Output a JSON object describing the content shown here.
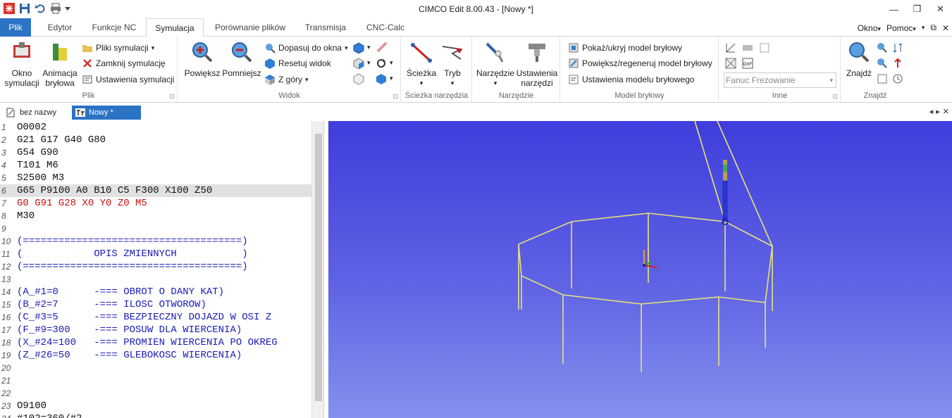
{
  "window": {
    "title": "CIMCO Edit 8.00.43 - [Nowy *]",
    "min": "—",
    "restore": "❐",
    "close": "✕"
  },
  "qat": {
    "icons": [
      "app-icon",
      "save-icon",
      "undo-icon",
      "print-icon",
      "dropdown-icon"
    ]
  },
  "tabs": [
    {
      "label": "Plik"
    },
    {
      "label": "Edytor"
    },
    {
      "label": "Funkcje NC"
    },
    {
      "label": "Symulacja"
    },
    {
      "label": "Porównanie plików"
    },
    {
      "label": "Transmisja"
    },
    {
      "label": "CNC-Calc"
    }
  ],
  "menus": {
    "okno": "Okno",
    "pomoc": "Pomoc",
    "arrow": "▾",
    "up": "▾",
    "pin": "⧉",
    "x": "✕"
  },
  "ribbon": {
    "plik": {
      "label": "Plik",
      "okno": "Okno symulacji",
      "okno_l1": "Okno",
      "okno_l2": "symulacji",
      "anim_l1": "Animacja",
      "anim_l2": "bryłowa",
      "pliki": "Pliki symulacji",
      "zamknij": "Zamknij symulację",
      "ustawienia": "Ustawienia symulacji",
      "launcher": "⊡"
    },
    "widok": {
      "label": "Widok",
      "powieksz": "Powiększ",
      "pomniejsz": "Pomniejsz",
      "dopasuj": "Dopasuj do okna",
      "resetuj": "Resetuj widok",
      "zgory": "Z góry",
      "launcher": "⊡"
    },
    "sciezka": {
      "label": "Ścieżka narzędzia",
      "sciezka": "Ścieżka",
      "tryb": "Tryb"
    },
    "narzedzie": {
      "label": "Narzędzie",
      "narzedzie": "Narzędzie",
      "ust_l1": "Ustawienia",
      "ust_l2": "narzędzi"
    },
    "model": {
      "label": "Model bryłowy",
      "pokaz": "Pokaż/ukryj model bryłowy",
      "powieksz": "Powiększ/regeneruj model bryłowy",
      "ustawienia": "Ustawienia modelu bryłowego"
    },
    "inne": {
      "label": "Inne",
      "select": "Fanuc Frezowanie",
      "launcher": "⊡"
    },
    "znajdz": {
      "label": "Znajdź",
      "znajdz": "Znajdź"
    }
  },
  "doctabs": [
    {
      "label": "bez nazwy"
    },
    {
      "label": "Nowy *"
    }
  ],
  "doctab_nav": {
    "left": "◂",
    "right": "▸",
    "close": "✕"
  },
  "editor": {
    "lines": [
      {
        "n": "1",
        "t": "O0002"
      },
      {
        "n": "2",
        "t": "G21 G17 G40 G80"
      },
      {
        "n": "3",
        "t": "G54 G90"
      },
      {
        "n": "4",
        "t": "T101 M6"
      },
      {
        "n": "5",
        "t": "S2500 M3"
      },
      {
        "n": "6",
        "t": "G65 P9100 A0 B10 C5 F300 X100 Z50"
      },
      {
        "n": "7",
        "t": "G0 G91 G28 X0 Y0 Z0 M5"
      },
      {
        "n": "8",
        "t": "M30"
      },
      {
        "n": "9",
        "t": ""
      },
      {
        "n": "10",
        "t": "(=====================================)"
      },
      {
        "n": "11",
        "t": "(            OPIS ZMIENNYCH           )"
      },
      {
        "n": "12",
        "t": "(=====================================)"
      },
      {
        "n": "13",
        "t": ""
      },
      {
        "n": "14",
        "t": "(A_#1=0      -=== OBROT O DANY KAT)"
      },
      {
        "n": "15",
        "t": "(B_#2=7      -=== ILOSC OTWOROW)"
      },
      {
        "n": "16",
        "t": "(C_#3=5      -=== BEZPIECZNY DOJAZD W OSI Z"
      },
      {
        "n": "17",
        "t": "(F_#9=300    -=== POSUW DLA WIERCENIA)"
      },
      {
        "n": "18",
        "t": "(X_#24=100   -=== PROMIEN WIERCENIA PO OKREG"
      },
      {
        "n": "19",
        "t": "(Z_#26=50    -=== GLEBOKOSC WIERCENIA)"
      },
      {
        "n": "20",
        "t": ""
      },
      {
        "n": "21",
        "t": ""
      },
      {
        "n": "22",
        "t": ""
      },
      {
        "n": "23",
        "t": "O9100"
      },
      {
        "n": "24",
        "t": "#102=360/#2"
      }
    ]
  },
  "colors": {
    "black": "#111111",
    "red": "#cc1010",
    "blue": "#1a1ab8",
    "wire": "#e8e27a",
    "bg_top": "#3f3ddc",
    "bg_bottom": "#8590ee"
  }
}
